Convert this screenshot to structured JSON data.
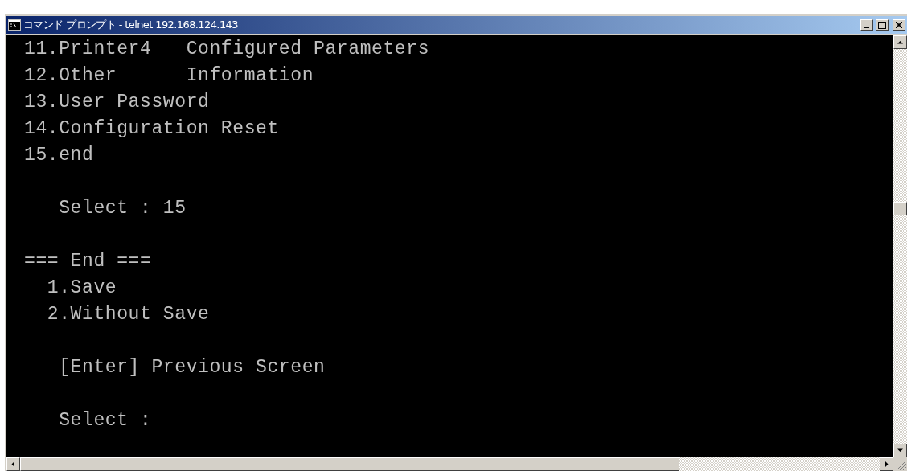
{
  "window": {
    "title": "コマンド プロンプト - telnet 192.168.124.143"
  },
  "terminal": {
    "lines": [
      {
        "kind": "text",
        "text": "11.Printer4   Configured Parameters"
      },
      {
        "kind": "text",
        "text": "12.Other      Information"
      },
      {
        "kind": "text",
        "text": "13.User Password"
      },
      {
        "kind": "text",
        "text": "14.Configuration Reset"
      },
      {
        "kind": "text",
        "text": "15.end"
      },
      {
        "kind": "blank"
      },
      {
        "kind": "text",
        "text": "   Select : 15"
      },
      {
        "kind": "blank"
      },
      {
        "kind": "text",
        "text": "=== End ==="
      },
      {
        "kind": "text",
        "text": "  1.Save"
      },
      {
        "kind": "text",
        "text": "  2.Without Save"
      },
      {
        "kind": "blank"
      },
      {
        "kind": "text",
        "text": "   [Enter] Previous Screen"
      },
      {
        "kind": "blank"
      },
      {
        "kind": "text",
        "text": "   Select :"
      }
    ]
  }
}
